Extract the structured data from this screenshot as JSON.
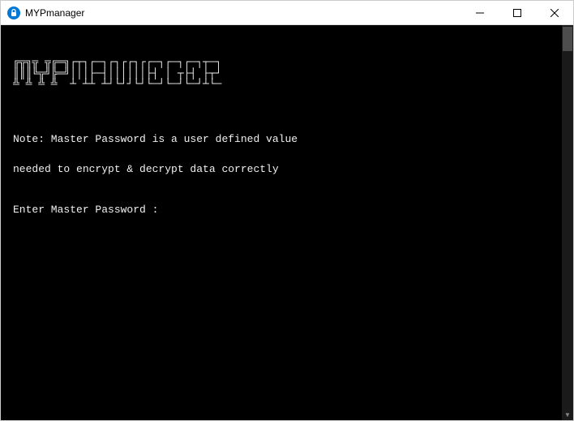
{
  "window": {
    "title": "MYPmanager"
  },
  "terminal": {
    "ascii_banner": "╔╦╗╦ ╦╔═╗┌┬┐┌─┐┌┐┌┌┐┌┌─┐┌─┐┌─┐┬─┐\n║║║╚╦╝╠═╝│││├─┤││││││├┤ │ ┬├┤ ├┬┘\n╩ ╩ ╩ ╩  ┴ ┴┴ ┴┘└┘┘└┘└─┘└─┘└─┘┴└─",
    "note_line1": "Note: Master Password is a user defined value",
    "note_line2": "needed to encrypt & decrypt data correctly",
    "prompt": "Enter Master Password : "
  },
  "icons": {
    "app_icon_bg": "#0078d4",
    "app_icon_fg": "#ffffff"
  }
}
